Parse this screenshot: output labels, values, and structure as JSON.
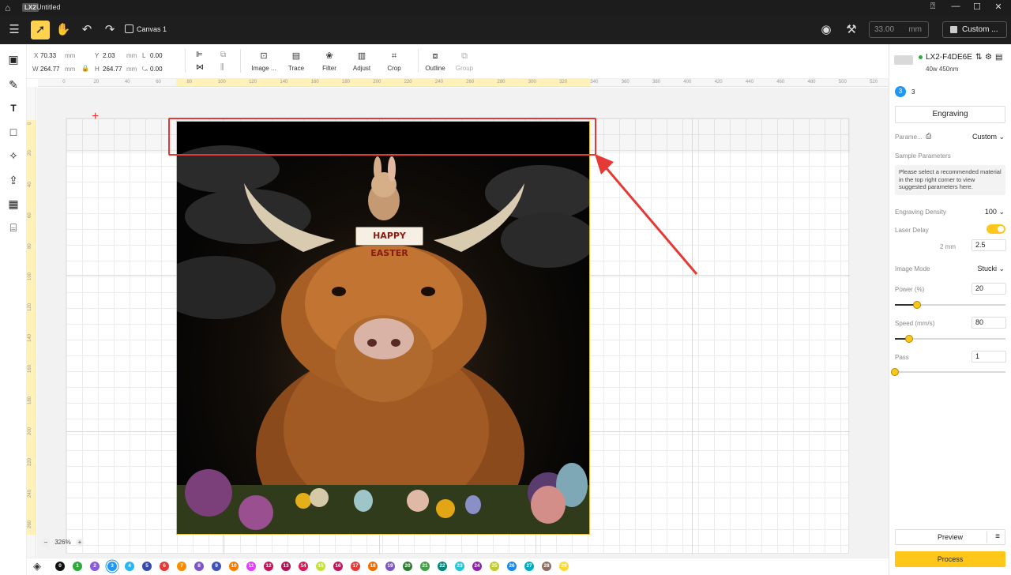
{
  "titlebar": {
    "app_badge": "LX2",
    "title": "Untitled"
  },
  "toolbar": {
    "canvas_label": "Canvas 1",
    "dimension_value": "33.00",
    "dimension_unit": "mm",
    "custom_label": "Custom ..."
  },
  "props": {
    "x_label": "X",
    "x_value": "70.33",
    "y_label": "Y",
    "y_value": "2.03",
    "w_label": "W",
    "w_value": "264.77",
    "h_label": "H",
    "h_value": "264.77",
    "unit": "mm",
    "l_label": "L",
    "l_value": "0.00",
    "r_value": "0.00",
    "tools": [
      "Image ...",
      "Trace",
      "Filter",
      "Adjust",
      "Crop",
      "Outline",
      "Group"
    ]
  },
  "hruler_ticks": [
    "20",
    "0",
    "20",
    "40",
    "60",
    "80",
    "100",
    "120",
    "140",
    "160",
    "180",
    "200",
    "220",
    "240",
    "260",
    "280",
    "300",
    "320",
    "340",
    "360",
    "380",
    "400",
    "420",
    "440",
    "460",
    "480",
    "500",
    "520"
  ],
  "vruler_ticks": [
    "0",
    "20",
    "40",
    "60",
    "80",
    "100",
    "120",
    "140",
    "160",
    "180",
    "200",
    "220",
    "240",
    "260"
  ],
  "artwork": {
    "sign_text": "HAPPY EASTER"
  },
  "zoom": {
    "minus": "−",
    "value": "326%",
    "plus": "+"
  },
  "layers": [
    {
      "n": "0",
      "c": "#111111"
    },
    {
      "n": "1",
      "c": "#2eaa3c"
    },
    {
      "n": "2",
      "c": "#8a5cd6"
    },
    {
      "n": "3",
      "c": "#2196f3"
    },
    {
      "n": "4",
      "c": "#29b6f6"
    },
    {
      "n": "5",
      "c": "#3949ab"
    },
    {
      "n": "6",
      "c": "#e53935"
    },
    {
      "n": "7",
      "c": "#fb8c00"
    },
    {
      "n": "8",
      "c": "#7e57c2"
    },
    {
      "n": "9",
      "c": "#3f51b5"
    },
    {
      "n": "10",
      "c": "#f57c00"
    },
    {
      "n": "11",
      "c": "#e040fb"
    },
    {
      "n": "12",
      "c": "#c2185b"
    },
    {
      "n": "13",
      "c": "#ad1457"
    },
    {
      "n": "14",
      "c": "#d81b60"
    },
    {
      "n": "15",
      "c": "#c6e03a"
    },
    {
      "n": "16",
      "c": "#c2185b"
    },
    {
      "n": "17",
      "c": "#e53935"
    },
    {
      "n": "18",
      "c": "#ef6c00"
    },
    {
      "n": "19",
      "c": "#7e57c2"
    },
    {
      "n": "20",
      "c": "#2e7d32"
    },
    {
      "n": "21",
      "c": "#43a047"
    },
    {
      "n": "22",
      "c": "#00897b"
    },
    {
      "n": "23",
      "c": "#26c6da"
    },
    {
      "n": "24",
      "c": "#8e24aa"
    },
    {
      "n": "25",
      "c": "#c0ca33"
    },
    {
      "n": "26",
      "c": "#1e88e5"
    },
    {
      "n": "27",
      "c": "#00acc1"
    },
    {
      "n": "28",
      "c": "#8d6e63"
    },
    {
      "n": "29",
      "c": "#fdd835"
    }
  ],
  "panel": {
    "device_name": "LX2-F4DE6E",
    "device_spec": "40w 450nm",
    "layer_num": "3",
    "layer_label": "3",
    "mode_button": "Engraving",
    "param_label": "Parame...",
    "param_value": "Custom",
    "sample_label": "Sample Parameters",
    "hint": "Please select a recommended material in the top right corner to view suggested parameters here.",
    "density_label": "Engraving Density",
    "density_value": "100",
    "laser_delay_label": "Laser Delay",
    "delay_unit": "2 mm",
    "delay_value": "2.5",
    "image_mode_label": "Image Mode",
    "image_mode_value": "Stucki",
    "power_label": "Power  (%)",
    "power_value": "20",
    "power_fraction": 0.2,
    "speed_label": "Speed  (mm/s)",
    "speed_value": "80",
    "speed_fraction": 0.13,
    "pass_label": "Pass",
    "pass_value": "1",
    "pass_fraction": 0.0,
    "preview_label": "Preview",
    "process_label": "Process"
  },
  "colors": {
    "accent": "#ffc71a",
    "highlight": "#e53935"
  }
}
